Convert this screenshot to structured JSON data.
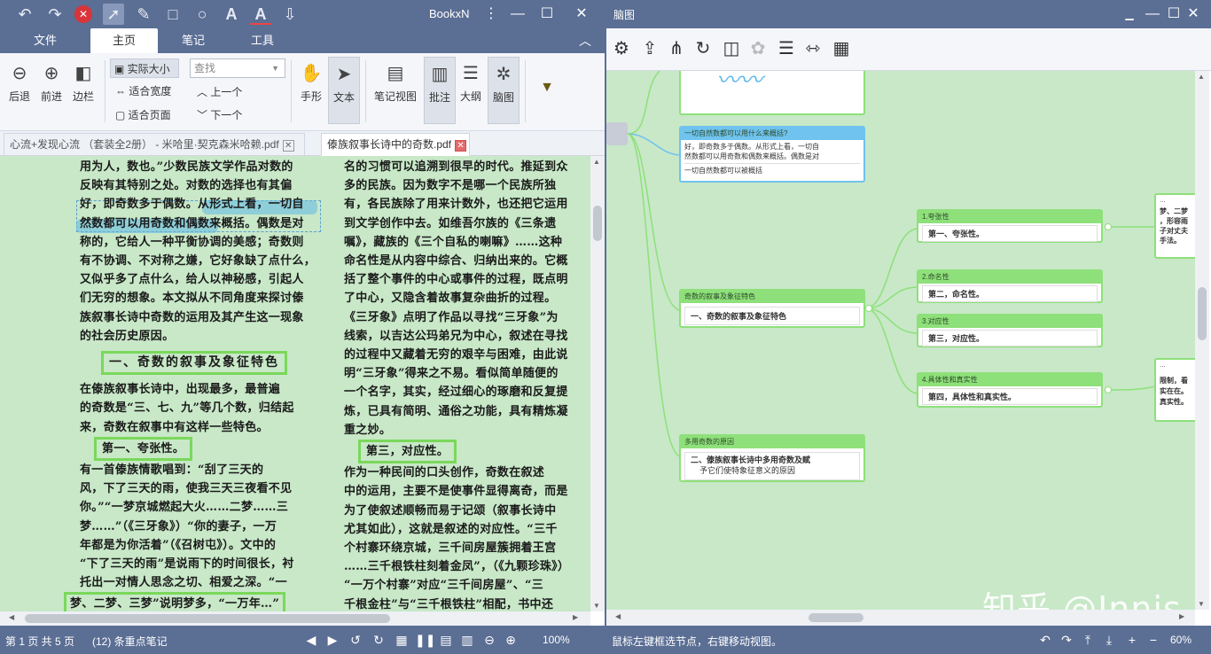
{
  "left_window": {
    "app_name": "BookxN",
    "ribbon_tabs": [
      "文件",
      "主页",
      "笔记",
      "工具"
    ],
    "ribbon": {
      "back": "后退",
      "forward": "前进",
      "sidebar": "边栏",
      "actual_size": "实际大小",
      "fit_width": "适合宽度",
      "fit_page": "适合页面",
      "search_placeholder": "查找",
      "prev": "上一个",
      "next": "下一个",
      "hand": "手形",
      "text": "文本",
      "note_view": "笔记视图",
      "annotate": "批注",
      "outline": "大纲",
      "mindmap": "脑图"
    },
    "doc_tabs": [
      "心流+发现心流 （套装全2册） - 米哈里·契克森米哈赖.pdf",
      "傣族叙事长诗中的奇数.pdf"
    ],
    "page_text": {
      "left_col": [
        "用为人，数也。”少数民族文学作品对数的",
        "反映有其特别之处。对数的选择也有其偏",
        "好，即奇数多于偶数。从形式上看，一切自",
        "然数都可以用奇数和偶数来概括。偶数是对",
        "称的，它给人一种平衡协调的美感；奇数则",
        "有不协调、不对称之嫌，它好象缺了点什么，",
        "又似乎多了点什么，给人以神秘感，引起人",
        "们无穷的想象。本文拟从不同角度来探讨傣",
        "族叙事长诗中奇数的运用及其产生这一现象",
        "的社会历史原因。"
      ],
      "heading1": "一、奇数的叙事及象征特色",
      "left_col2": [
        "在傣族叙事长诗中，出现最多，最普遍",
        "的奇数是“三、七、九”等几个数，归结起",
        "来，奇数在叙事中有这样一些特色。"
      ],
      "sub1": "第一、夸张性。",
      "left_col3": [
        "有一首傣族情歌唱到：“刮了三天的",
        "风，下了三天的雨，使我三天三夜看不见",
        "你。”“一梦京城燃起大火……二梦……三",
        "梦……”（《三牙象》）“你的妻子，一万",
        "年都是为你活着”（《召树屯》）。文中的",
        "“下了三天的雨”是说雨下的时间很长，衬",
        "托出一对情人思念之切、相爱之深。“一"
      ],
      "left_last": "梦、二梦、三梦”说明梦多，“一万年…”",
      "right_col": [
        "名的习惯可以追溯到很早的时代。推延到众",
        "多的民族。因为数字不是哪一个民族所独",
        "有，各民族除了用来计数外，也还把它运用",
        "到文学创作中去。如维吾尔族的《三条遗",
        "嘱》，藏族的《三个自私的喇嘛》……这种",
        "命名性是从内容中综合、归纳出来的。它概",
        "括了整个事件的中心或事件的过程，既点明",
        "了中心，又隐含着故事复杂曲折的过程。",
        "《三牙象》点明了作品以寻找“三牙象”为",
        "线索，以吉达公玛弟兄为中心，叙述在寻找",
        "的过程中又藏着无穷的艰辛与困难，由此说",
        "明“三牙象”得来之不易。看似简单随便的",
        "一个名字，其实，经过细心的琢磨和反复提",
        "炼，已具有简明、通俗之功能，具有精炼凝",
        "重之妙。"
      ],
      "sub3": "第三，对应性。",
      "right_col2": [
        "作为一种民间的口头创作，奇数在叙述",
        "中的运用，主要不是使事件显得离奇，而是",
        "为了使叙述顺畅而易于记颂（叙事长诗中",
        "尤其如此），这就是叙述的对应性。“三千",
        "个村寨环绕京城，三千间房屋簇拥着王宫",
        "……三千根铁柱刻着金凤”，（《九颗珍珠》）",
        "“一万个村寨”对应“三千间房屋”、“三",
        "千根金柱”与“三千根铁柱”相配，书中还"
      ]
    },
    "status": {
      "page_info": "第 1 页 共 5 页",
      "notes": "(12) 条重点笔记",
      "zoom": "100%"
    }
  },
  "right_window": {
    "title": "脑图",
    "status_hint": "鼠标左键框选节点，右键移动视图。",
    "zoom": "60%",
    "nodes": {
      "top_partial_header": "一切自然数都可以用什么来概括?",
      "top_partial_body1": "好，即奇数多于偶数。从形式上看，一切自",
      "top_partial_body2": "然数都可以用奇数和偶数来概括。偶数是对",
      "top_partial_note": "一切自然数都可以被概括",
      "n1_header": "奇数的叙事及象征特色",
      "n1_body": "一、奇数的叙事及象征特色",
      "n2_header": "1.夸张性",
      "n2_body": "第一、夸张性。",
      "n3_header": "2.命名性",
      "n3_body": "第二，命名性。",
      "n4_header": "3.对应性",
      "n4_body": "第三，对应性。",
      "n5_header": "4.具体性和真实性",
      "n5_body": "第四，具体性和真实性。",
      "n6_header": "多用奇数的原因",
      "n6_body1": "二、傣族叙事长诗中多用奇数及赋",
      "n6_body2": "予它们使特象征意义的原因",
      "p1_header": "...",
      "p1_body": [
        "梦、二梦",
        "，形容雨",
        "子对丈夫",
        "手法。"
      ],
      "p2_header": "...",
      "p2_body": [
        "限制，看",
        "实在在。",
        "真实性。"
      ]
    },
    "watermark": "知乎 @Innis"
  }
}
